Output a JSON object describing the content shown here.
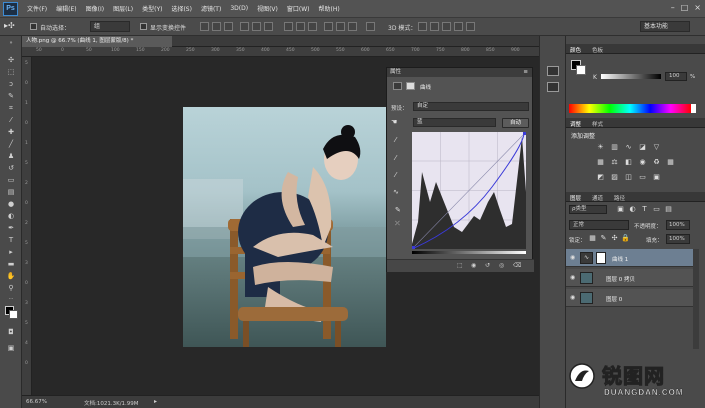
{
  "menubar": {
    "logo": "Ps",
    "items": [
      "文件(F)",
      "编辑(E)",
      "图像(I)",
      "图层(L)",
      "类型(Y)",
      "选择(S)",
      "滤镜(T)",
      "3D(D)",
      "视图(V)",
      "窗口(W)",
      "帮助(H)"
    ],
    "window_controls": [
      "–",
      "□",
      "×"
    ]
  },
  "options_bar": {
    "auto_select_label": "自动选择：",
    "auto_select_value": "组",
    "show_transform_label": "显示变换控件",
    "mode_3d_label": "3D 模式：",
    "workspace": "基本功能"
  },
  "document_tab": {
    "title": "人物.png @ 66.7% (曲线 1, 图层蒙版/8) *"
  },
  "ruler": {
    "top_ticks": [
      "50",
      "0",
      "50",
      "100",
      "150",
      "200",
      "250",
      "300",
      "350",
      "400",
      "450",
      "500",
      "550",
      "600",
      "650",
      "700",
      "750",
      "800",
      "850",
      "900"
    ],
    "left_ticks": [
      "5",
      "0",
      "1",
      "0",
      "1",
      "5",
      "2",
      "0",
      "2",
      "5",
      "3",
      "0",
      "3",
      "5",
      "4",
      "0"
    ]
  },
  "status_bar": {
    "zoom": "66.67%",
    "doc_info": "文档:1021.3K/1.99M"
  },
  "curves_panel": {
    "panel_title": "属性",
    "tab_label": "曲线",
    "preset_label": "预设：",
    "preset_value": "自定",
    "channel_value": "蓝",
    "auto_button": "自动"
  },
  "color_panel": {
    "tabs": [
      "颜色",
      "色板"
    ],
    "slider_label": "K",
    "slider_value": "100",
    "percent": "%"
  },
  "adjustments_panel": {
    "tabs": [
      "调整",
      "样式"
    ],
    "heading": "添加调整"
  },
  "layers_panel": {
    "tabs": [
      "图层",
      "通道",
      "路径"
    ],
    "filter_label": "ρ类型",
    "blend_mode": "正常",
    "opacity_label": "不透明度：",
    "opacity_value": "100%",
    "lock_label": "锁定：",
    "fill_label": "填充：",
    "fill_value": "100%",
    "layers": [
      {
        "name": "曲线 1",
        "selected": true
      },
      {
        "name": "图层 0 拷贝",
        "selected": false
      },
      {
        "name": "图层 0",
        "selected": false
      }
    ]
  },
  "watermark": {
    "brand": "锐图网",
    "url": "DUANGDAN.COM"
  },
  "colors": {
    "accent_selection": "#6d7f92",
    "curve_line": "#3a3ad8"
  }
}
